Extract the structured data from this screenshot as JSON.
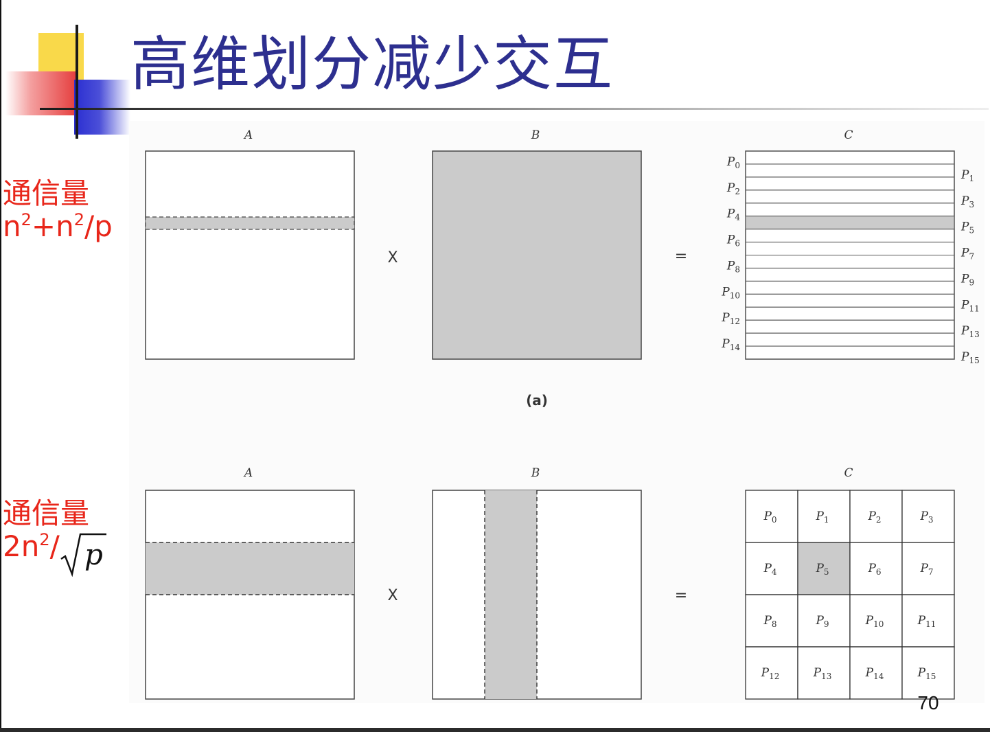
{
  "slide": {
    "title": "高维划分减少交互",
    "page_number": "70"
  },
  "annotations": [
    {
      "label": "通信量",
      "formula_parts": [
        "n",
        "2",
        "+n",
        "2",
        "/p"
      ]
    },
    {
      "label": "通信量",
      "formula_parts": [
        "2n",
        "2",
        "/"
      ],
      "radicand": "p"
    }
  ],
  "figure": {
    "panel_a": {
      "matrix_labels": [
        "A",
        "B",
        "C"
      ],
      "operator_multiply": "X",
      "operator_equals": "=",
      "caption": "(a)",
      "row_processors_left": [
        "P0",
        "P2",
        "P4",
        "P6",
        "P8",
        "P10",
        "P12",
        "P14"
      ],
      "row_processors_right": [
        "P1",
        "P3",
        "P5",
        "P7",
        "P9",
        "P11",
        "P13",
        "P15"
      ],
      "highlight_row": 5
    },
    "panel_b": {
      "matrix_labels": [
        "A",
        "B",
        "C"
      ],
      "operator_multiply": "X",
      "operator_equals": "=",
      "grid": [
        [
          "P0",
          "P1",
          "P2",
          "P3"
        ],
        [
          "P4",
          "P5",
          "P6",
          "P7"
        ],
        [
          "P8",
          "P9",
          "P10",
          "P11"
        ],
        [
          "P12",
          "P13",
          "P14",
          "P15"
        ]
      ],
      "highlight_cell": [
        1,
        1
      ]
    },
    "colors": {
      "shade": "#cbcbcb",
      "line": "#333333"
    }
  }
}
